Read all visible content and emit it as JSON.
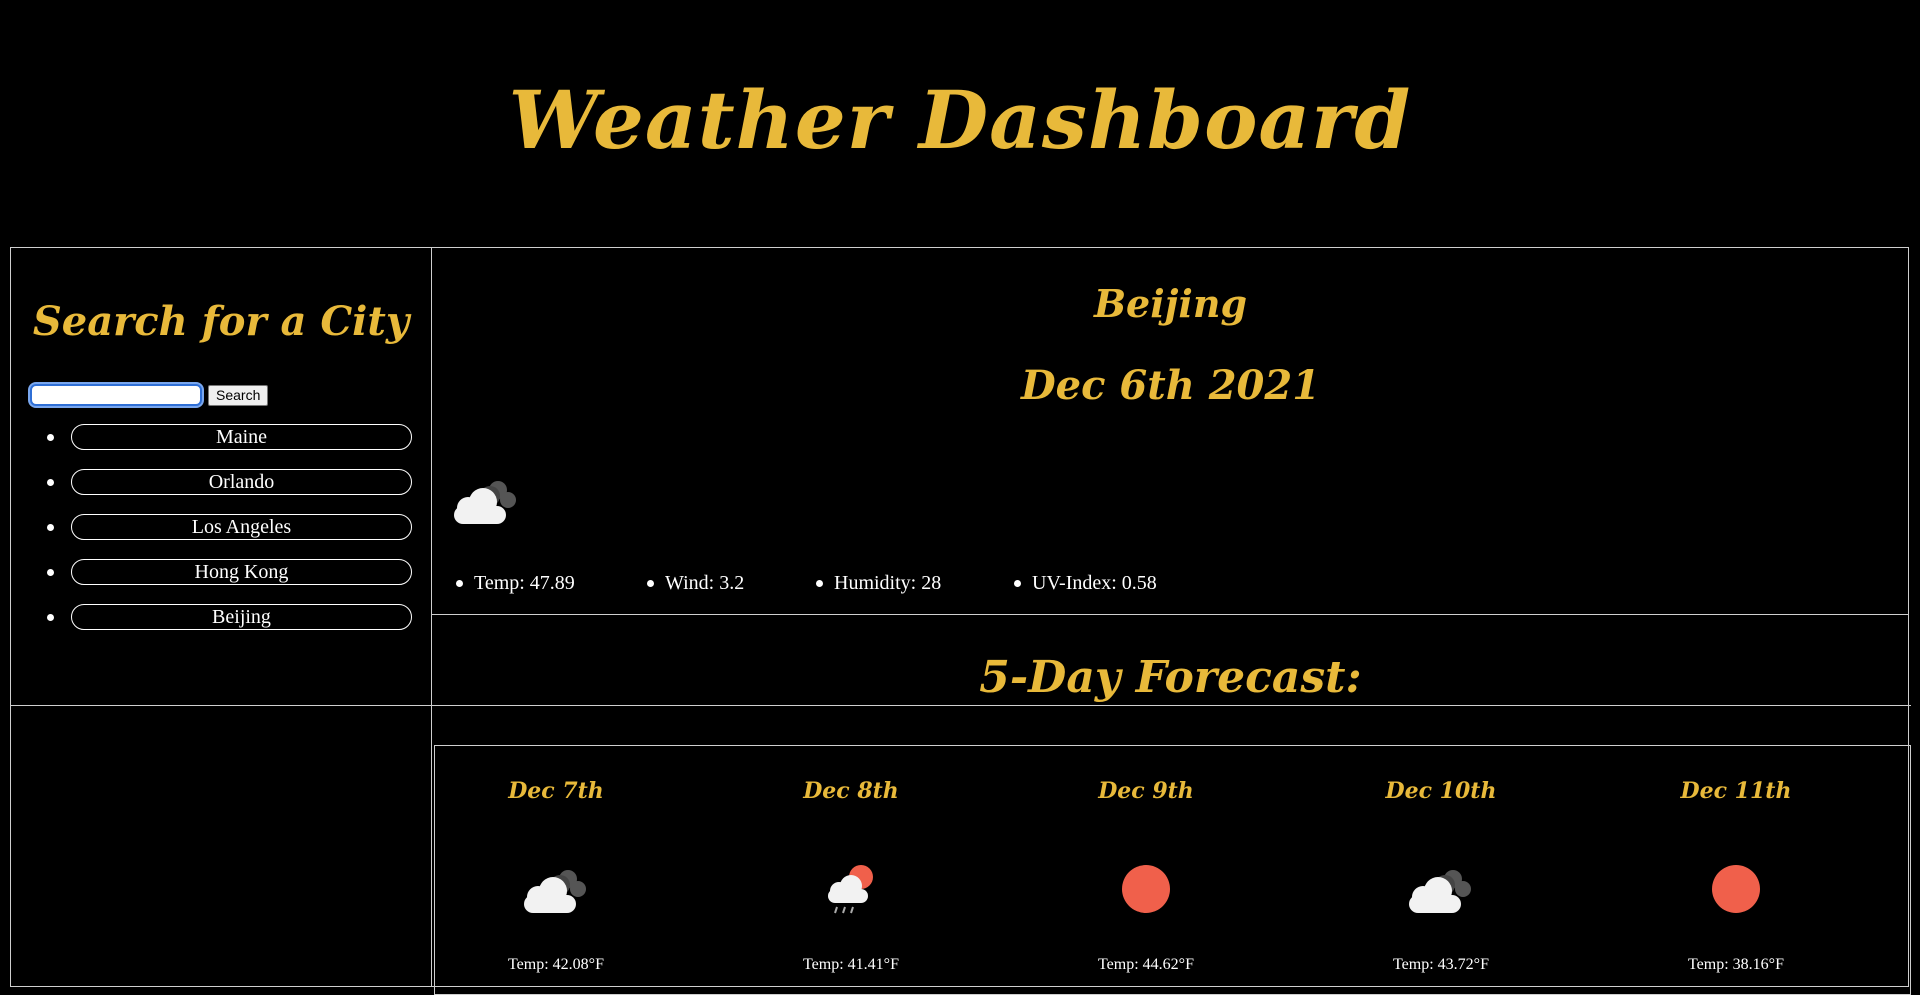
{
  "header": {
    "title": "Weather Dashboard"
  },
  "sidebar": {
    "title": "Search for a City",
    "search": {
      "value": "",
      "placeholder": "",
      "button_label": "Search"
    },
    "cities": [
      "Maine",
      "Orlando",
      "Los Angeles",
      "Hong Kong",
      "Beijing"
    ]
  },
  "current": {
    "city": "Beijing",
    "date": "Dec 6th 2021",
    "icon": "cloudy-icon",
    "stats": {
      "temp": "Temp: 47.89",
      "wind": "Wind: 3.2",
      "humidity": "Humidity: 28",
      "uv": "UV-Index: 0.58"
    }
  },
  "forecast": {
    "title": "5-Day Forecast:",
    "days": [
      {
        "date": "Dec 7th",
        "icon": "cloudy-icon",
        "temp": "Temp: 42.08°F"
      },
      {
        "date": "Dec 8th",
        "icon": "rain-sun-icon",
        "temp": "Temp: 41.41°F"
      },
      {
        "date": "Dec 9th",
        "icon": "sun-icon",
        "temp": "Temp: 44.62°F"
      },
      {
        "date": "Dec 10th",
        "icon": "cloudy-icon",
        "temp": "Temp: 43.72°F"
      },
      {
        "date": "Dec 11th",
        "icon": "sun-icon",
        "temp": "Temp: 38.16°F"
      }
    ]
  },
  "colors": {
    "accent": "#e8b93a",
    "sun": "#f0604b",
    "background": "#000000"
  }
}
